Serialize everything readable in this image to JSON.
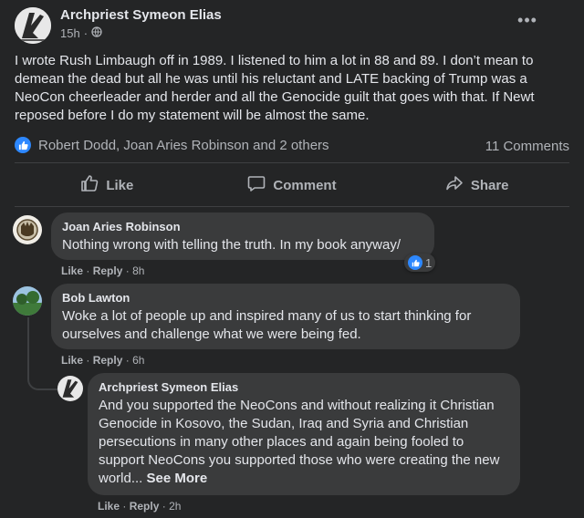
{
  "post": {
    "author": "Archpriest Symeon Elias",
    "time": "15h",
    "dot": "·",
    "more_icon": "more-horizontal-icon",
    "text": "I wrote Rush Limbaugh off in 1989. I listened to him a lot in 88 and 89. I don’t mean to demean the dead but all he was until his reluctant and LATE backing of Trump was a NeoCon cheerleader and herder and all the Genocide guilt that goes with that. If Newt reposed before I do my statement will be almost the same.",
    "reactions_text": "Robert Dodd, Joan Aries Robinson and 2 others",
    "comments_count": "11 Comments"
  },
  "actions": {
    "like": "Like",
    "comment": "Comment",
    "share": "Share"
  },
  "colors": {
    "background": "#242526",
    "bubble": "#3a3b3c",
    "accent": "#2d88ff",
    "secondary_text": "#b0b3b8"
  },
  "comments": [
    {
      "author": "Joan Aries Robinson",
      "text": "Nothing wrong with telling the truth. In my book anyway/",
      "like": "Like",
      "reply": "Reply",
      "sep": "·",
      "time": "8h",
      "reaction_count": "1"
    },
    {
      "author": "Bob Lawton",
      "text": "Woke a lot of people up and inspired many of us to start thinking for ourselves and challenge what we were being fed.",
      "like": "Like",
      "reply": "Reply",
      "sep": "·",
      "time": "6h"
    },
    {
      "author": "Archpriest Symeon Elias",
      "text": "And you supported the NeoCons and without realizing it Christian Genocide in Kosovo, the Sudan, Iraq and Syria and Christian persecutions in many other places and again being fooled to support NeoCons you supported those who were creating the new world...",
      "see_more": "See More",
      "like": "Like",
      "reply": "Reply",
      "sep": "·",
      "time": "2h"
    }
  ]
}
